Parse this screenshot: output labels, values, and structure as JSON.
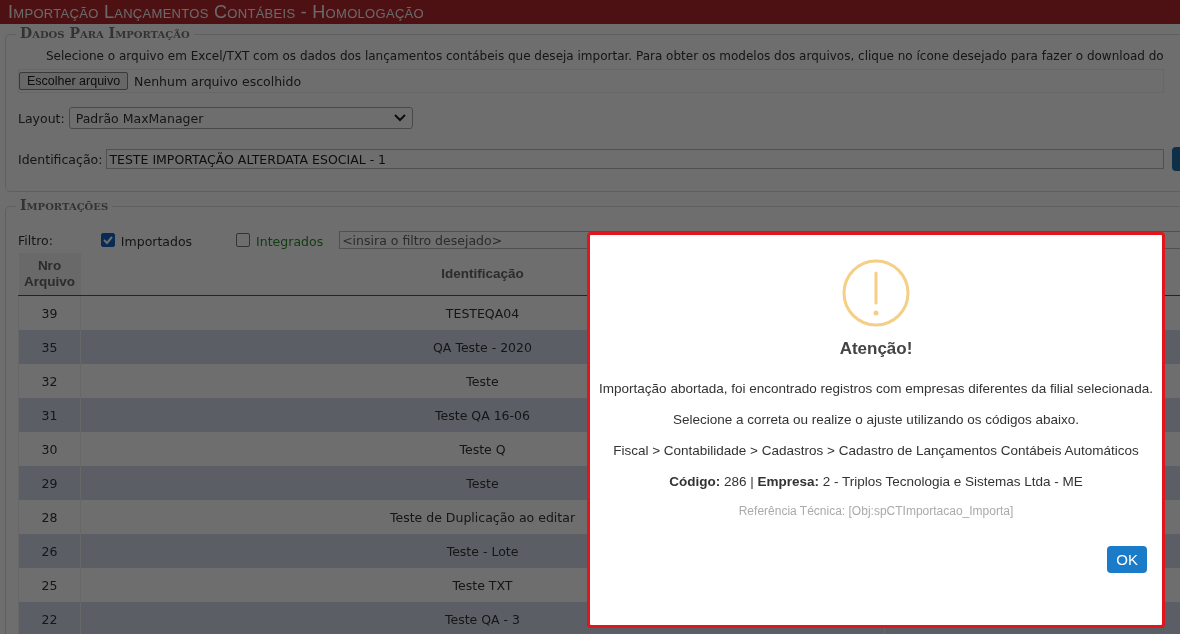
{
  "title": "Importação Lançamentos Contábeis  - Homologação",
  "import_data": {
    "legend": "Dados Para Importação",
    "instructions": "Selecione o arquivo em Excel/TXT com os dados dos lançamentos contábeis que deseja importar. Para obter os modelos dos arquivos, clique no ícone desejado para fazer o download do",
    "file_button": "Escolher arquivo",
    "file_status": "Nenhum arquivo escolhido",
    "layout_label": "Layout:",
    "layout_value": "Padrão MaxManager",
    "identification_label": "Identificação:",
    "identification_value": "TESTE IMPORTAÇÃO ALTERDATA ESOCIAL - 1"
  },
  "imports": {
    "legend": "Importações",
    "filter_label": "Filtro:",
    "filters": [
      {
        "label": "Importados",
        "checked": true
      },
      {
        "label": "Integrados",
        "checked": false
      }
    ],
    "filter_placeholder": "<insira o filtro desejado>",
    "table": {
      "columns": [
        "Nro Arquivo",
        "Identificação"
      ],
      "rows": [
        [
          "39",
          "TESTEQA04"
        ],
        [
          "35",
          "QA Teste - 2020"
        ],
        [
          "32",
          "Teste"
        ],
        [
          "31",
          "Teste QA 16-06"
        ],
        [
          "30",
          "Teste Q"
        ],
        [
          "29",
          "Teste"
        ],
        [
          "28",
          "Teste de Duplicação ao editar"
        ],
        [
          "26",
          "Teste - Lote"
        ],
        [
          "25",
          "Teste TXT"
        ],
        [
          "22",
          "Teste QA - 3"
        ]
      ]
    }
  },
  "dialog": {
    "title": "Atenção!",
    "paragraphs": [
      "Importação abortada, foi encontrado registros com empresas diferentes da filial selecionada.",
      "Selecione a correta ou realize o ajuste utilizando os códigos abaixo.",
      "Fiscal > Contabilidade > Cadastros > Cadastro de Lançamentos Contábeis Automáticos",
      "**Código:** 286 | **Empresa:** 2 - Triplos Tecnologia e Sistemas Ltda - ME"
    ],
    "reference": "Referência Técnica: [Obj:spCTImportacao_Importa]",
    "ok_button": "OK"
  }
}
